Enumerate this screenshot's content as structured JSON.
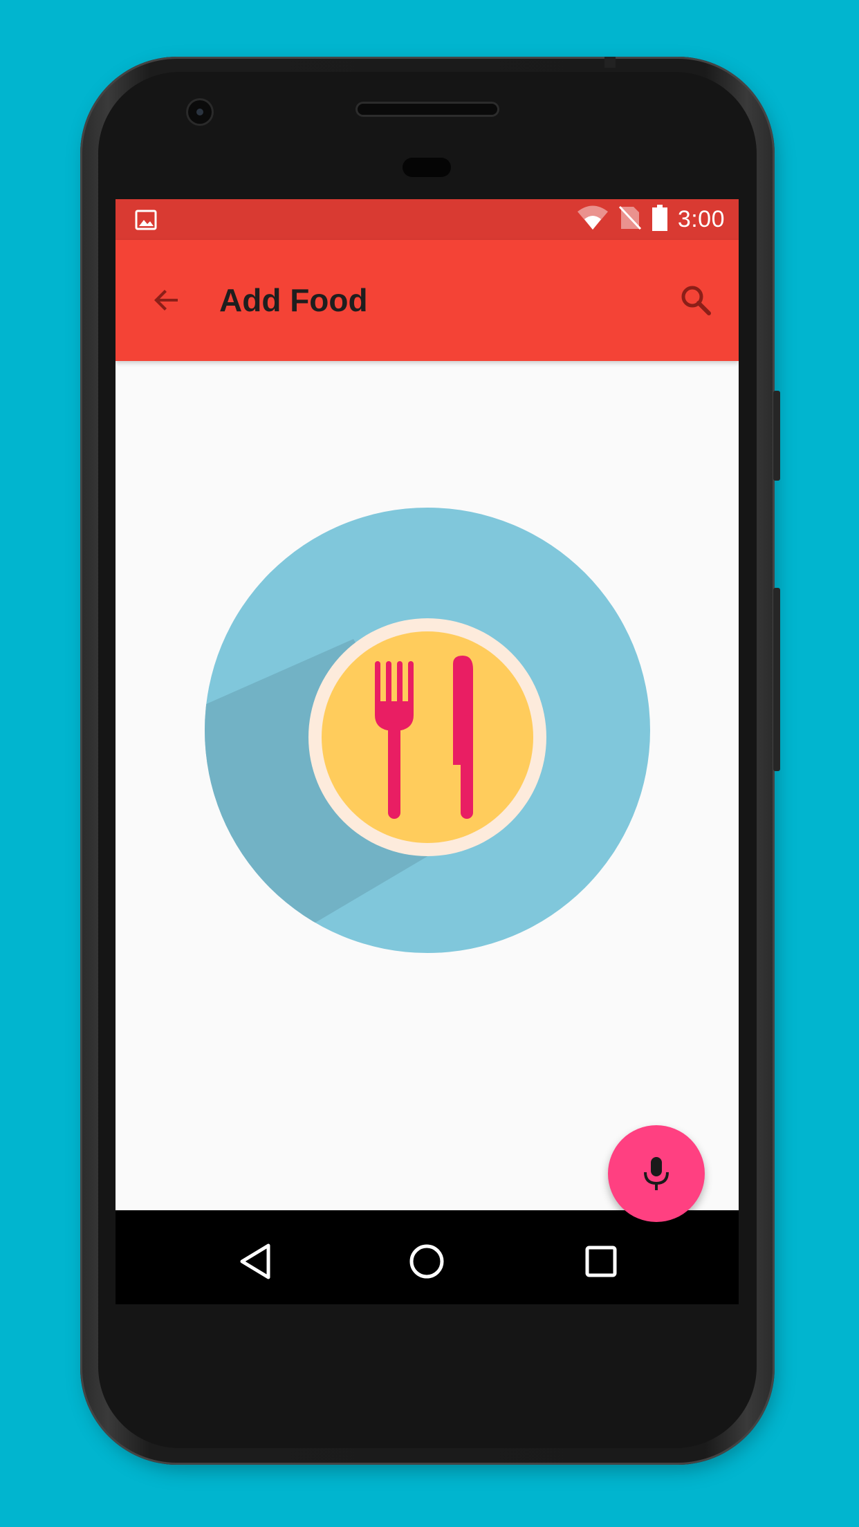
{
  "status_bar": {
    "time": "3:00",
    "icons": [
      "image-notification-icon",
      "wifi-icon",
      "no-sim-icon",
      "battery-icon"
    ]
  },
  "app_bar": {
    "title": "Add Food",
    "back_icon": "arrow-back-icon",
    "search_icon": "search-icon"
  },
  "main": {
    "illustration": "plate-fork-knife-icon"
  },
  "fab": {
    "icon": "microphone-icon"
  },
  "nav_bar": {
    "buttons": [
      "back-icon",
      "home-icon",
      "recents-icon"
    ]
  },
  "colors": {
    "background": "#01B5CF",
    "status_bar": "#D93A32",
    "app_bar": "#F44336",
    "fab": "#FF4081",
    "plate_outer": "#80C7DB",
    "plate_inner": "#FFCC5C",
    "cutlery": "#E91E63"
  }
}
